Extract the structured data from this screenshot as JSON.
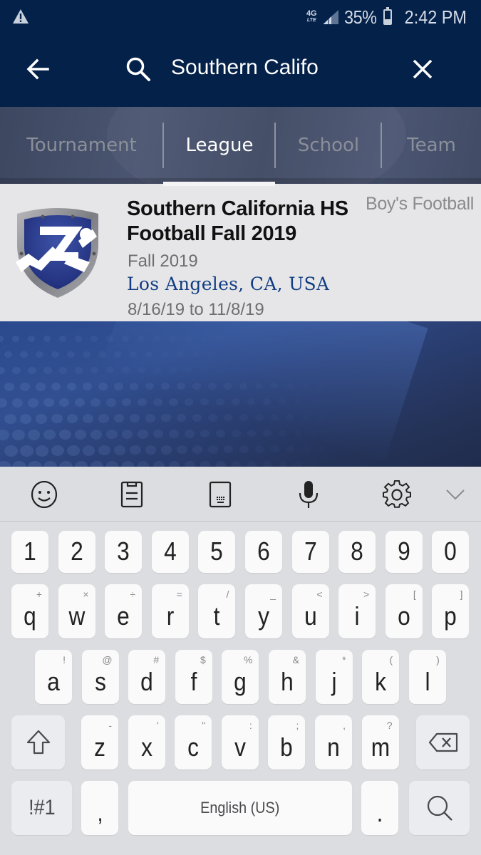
{
  "status_bar": {
    "warning_icon": "warning-triangle-icon",
    "network": "4G",
    "network_sub": "LTE",
    "signal_icon": "signal-strength-icon",
    "battery_percent_label": "35%",
    "battery_level": 0.35,
    "time": "2:42 PM"
  },
  "app_bar": {
    "back_icon": "arrow-left-icon",
    "search_icon": "search-icon",
    "search_value": "Southern Califo",
    "clear_icon": "close-icon"
  },
  "tabs": {
    "items": [
      {
        "label": "Tournament",
        "active": false
      },
      {
        "label": "League",
        "active": true
      },
      {
        "label": "School",
        "active": false
      },
      {
        "label": "Team",
        "active": false
      }
    ]
  },
  "result": {
    "logo_icon": "league-shield-logo-icon",
    "title": "Southern California HS Football Fall 2019",
    "sport": "Boy's Football",
    "season": "Fall 2019",
    "location": "Los Angeles, CA, USA",
    "dates": "8/16/19 to 11/8/19"
  },
  "keyboard": {
    "toolbar": [
      "emoji-icon",
      "clipboard-icon",
      "keyboard-mode-icon",
      "microphone-icon",
      "settings-gear-icon",
      "chevron-down-icon"
    ],
    "number_row": [
      "1",
      "2",
      "3",
      "4",
      "5",
      "6",
      "7",
      "8",
      "9",
      "0"
    ],
    "row1": [
      {
        "key": "q",
        "alt": "+"
      },
      {
        "key": "w",
        "alt": "×"
      },
      {
        "key": "e",
        "alt": "÷"
      },
      {
        "key": "r",
        "alt": "="
      },
      {
        "key": "t",
        "alt": "/"
      },
      {
        "key": "y",
        "alt": "_"
      },
      {
        "key": "u",
        "alt": "<"
      },
      {
        "key": "i",
        "alt": ">"
      },
      {
        "key": "o",
        "alt": "["
      },
      {
        "key": "p",
        "alt": "]"
      }
    ],
    "row2": [
      {
        "key": "a",
        "alt": "!"
      },
      {
        "key": "s",
        "alt": "@"
      },
      {
        "key": "d",
        "alt": "#"
      },
      {
        "key": "f",
        "alt": "$"
      },
      {
        "key": "g",
        "alt": "%"
      },
      {
        "key": "h",
        "alt": "&"
      },
      {
        "key": "j",
        "alt": "*"
      },
      {
        "key": "k",
        "alt": "("
      },
      {
        "key": "l",
        "alt": ")"
      }
    ],
    "row3": [
      {
        "key": "z",
        "alt": "-"
      },
      {
        "key": "x",
        "alt": "'"
      },
      {
        "key": "c",
        "alt": "\""
      },
      {
        "key": "v",
        "alt": ":"
      },
      {
        "key": "b",
        "alt": ";"
      },
      {
        "key": "n",
        "alt": ","
      },
      {
        "key": "m",
        "alt": "?"
      }
    ],
    "shift_icon": "shift-arrow-icon",
    "backspace_icon": "backspace-icon",
    "symbols_label": "!#1",
    "comma": ",",
    "space_label": "English (US)",
    "period": ".",
    "search_key_icon": "search-icon"
  }
}
